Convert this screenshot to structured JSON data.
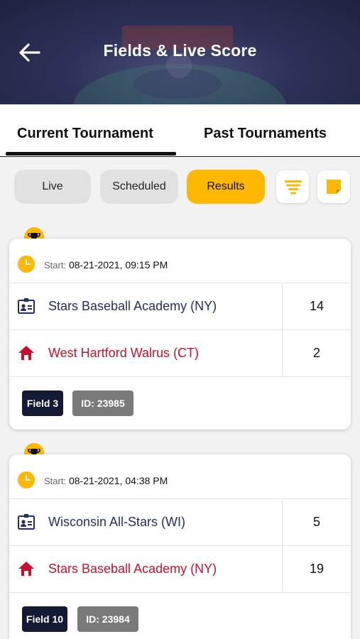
{
  "header": {
    "title": "Fields & Live Score"
  },
  "tabs": [
    {
      "label": "Current Tournament",
      "active": true
    },
    {
      "label": "Past Tournaments",
      "active": false
    }
  ],
  "segments": {
    "live": "Live",
    "scheduled": "Scheduled",
    "results": "Results",
    "selected": "Results"
  },
  "colors": {
    "accent": "#ffb800",
    "navy": "#1f2e5c",
    "home_red": "#c8102e",
    "field_badge": "#141a33",
    "id_badge": "#7a7a7a"
  },
  "icons": {
    "back": "arrow-left-icon",
    "filter": "filter-icon",
    "note": "sticky-note-icon",
    "trophy": "trophy-icon",
    "clock": "clock-icon",
    "away": "id-badge-icon",
    "home": "home-icon"
  },
  "start_label": "Start:",
  "matches": [
    {
      "start": "08-21-2021, 09:15 PM",
      "away": {
        "name": "Stars Baseball Academy (NY)",
        "score": "14"
      },
      "home": {
        "name": "West Hartford Walrus (CT)",
        "score": "2"
      },
      "field": "Field 3",
      "id": "ID:  23985"
    },
    {
      "start": "08-21-2021, 04:38 PM",
      "away": {
        "name": "Wisconsin All-Stars (WI)",
        "score": "5"
      },
      "home": {
        "name": "Stars Baseball Academy (NY)",
        "score": "19"
      },
      "field": "Field 10",
      "id": "ID:  23984"
    }
  ]
}
